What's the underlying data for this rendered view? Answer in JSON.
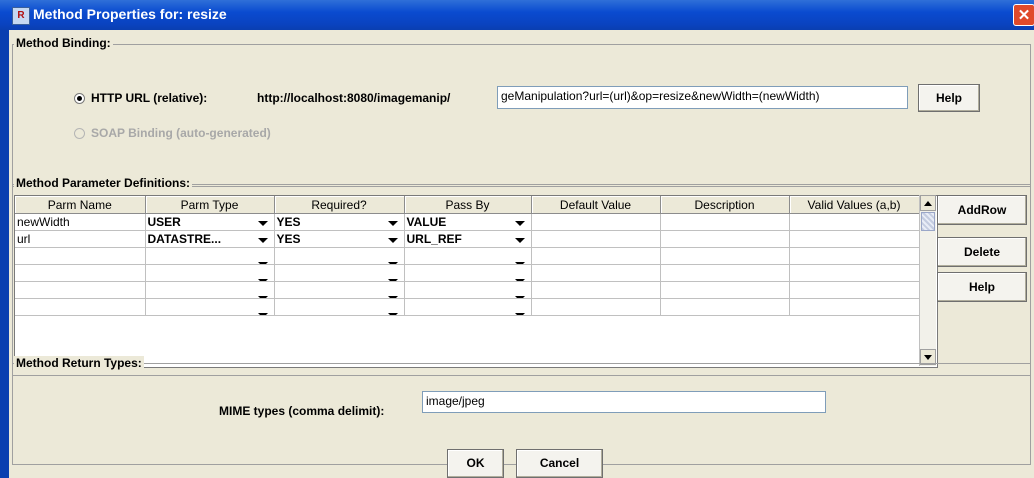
{
  "window": {
    "title": "Method Properties for: resize",
    "close_glyph": "✕",
    "app_icon": "R"
  },
  "binding": {
    "legend": "Method Binding:",
    "http_label": "HTTP URL (relative):",
    "base_url": "http://localhost:8080/imagemanip/",
    "url_value": "geManipulation?url=(url)&op=resize&newWidth=(newWidth)",
    "help_label": "Help",
    "soap_label": "SOAP Binding (auto-generated)"
  },
  "params": {
    "legend": "Method Parameter Definitions:",
    "columns": [
      "Parm Name",
      "Parm Type",
      "Required?",
      "Pass By",
      "Default Value",
      "Description",
      "Valid Values (a,b)"
    ],
    "rows": [
      {
        "name": "newWidth",
        "type": "USER",
        "required": "YES",
        "pass_by": "VALUE",
        "default": "",
        "description": "",
        "valid": ""
      },
      {
        "name": "url",
        "type": "DATASTRE...",
        "required": "YES",
        "pass_by": "URL_REF",
        "default": "",
        "description": "",
        "valid": ""
      },
      {
        "name": "",
        "type": "",
        "required": "",
        "pass_by": "",
        "default": "",
        "description": "",
        "valid": ""
      },
      {
        "name": "",
        "type": "",
        "required": "",
        "pass_by": "",
        "default": "",
        "description": "",
        "valid": ""
      },
      {
        "name": "",
        "type": "",
        "required": "",
        "pass_by": "",
        "default": "",
        "description": "",
        "valid": ""
      },
      {
        "name": "",
        "type": "",
        "required": "",
        "pass_by": "",
        "default": "",
        "description": "",
        "valid": ""
      }
    ],
    "addrow_label": "AddRow",
    "delete_label": "Delete",
    "help_label": "Help"
  },
  "returns": {
    "legend": "Method Return Types:",
    "mime_label": "MIME types (comma delimit):",
    "mime_value": "image/jpeg"
  },
  "footer": {
    "ok_label": "OK",
    "cancel_label": "Cancel"
  }
}
